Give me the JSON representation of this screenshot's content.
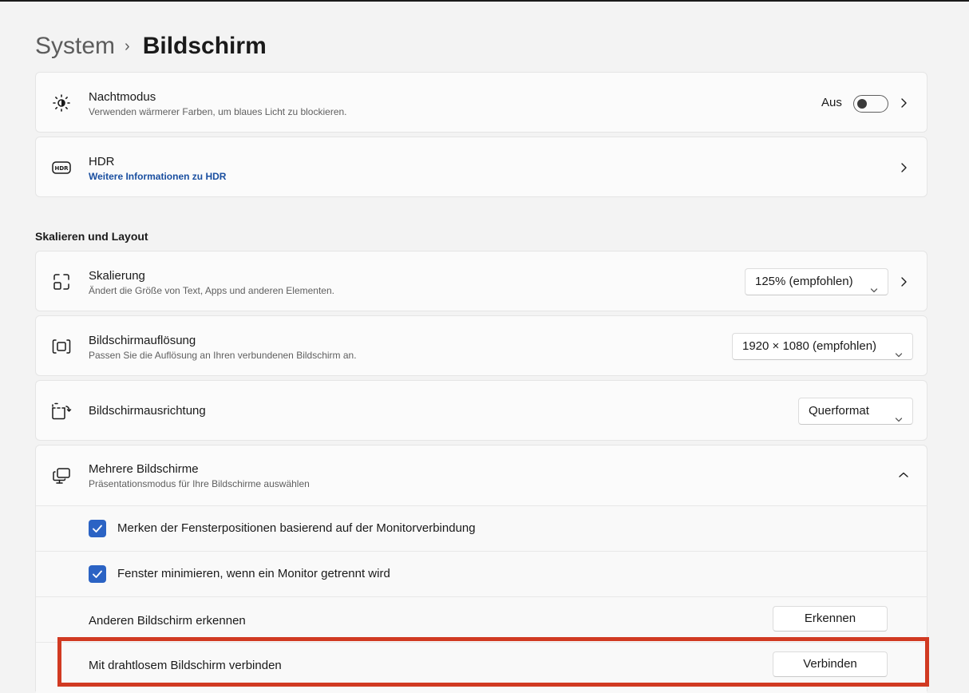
{
  "breadcrumb": {
    "parent": "System",
    "separator": "›",
    "current": "Bildschirm"
  },
  "night_mode": {
    "title": "Nachtmodus",
    "subtitle": "Verwenden wärmerer Farben, um blaues Licht zu blockieren.",
    "toggle_label": "Aus",
    "toggle_on": false,
    "icon": "brightness-icon"
  },
  "hdr": {
    "title": "HDR",
    "link": "Weitere Informationen zu HDR",
    "icon": "hdr-icon"
  },
  "section": {
    "label": "Skalieren und Layout"
  },
  "scaling": {
    "title": "Skalierung",
    "subtitle": "Ändert die Größe von Text, Apps und anderen Elementen.",
    "selected": "125% (empfohlen)",
    "icon": "scale-icon"
  },
  "resolution": {
    "title": "Bildschirmauflösung",
    "subtitle": "Passen Sie die Auflösung an Ihren verbundenen Bildschirm an.",
    "selected": "1920 × 1080 (empfohlen)",
    "icon": "resolution-icon"
  },
  "orientation": {
    "title": "Bildschirmausrichtung",
    "selected": "Querformat",
    "icon": "orientation-icon"
  },
  "multiple_displays": {
    "title": "Mehrere Bildschirme",
    "subtitle": "Präsentationsmodus für Ihre Bildschirme auswählen",
    "icon": "multiple-displays-icon",
    "expanded": true,
    "options": [
      {
        "label": "Merken der Fensterpositionen basierend auf der Monitorverbindung",
        "checked": true
      },
      {
        "label": "Fenster minimieren, wenn ein Monitor getrennt wird",
        "checked": true
      }
    ],
    "detect": {
      "label": "Anderen Bildschirm erkennen",
      "button": "Erkennen"
    },
    "wireless": {
      "label": "Mit drahtlosem Bildschirm verbinden",
      "button": "Verbinden"
    }
  },
  "colors": {
    "accent": "#2b63c4",
    "link": "#1a4fa0",
    "highlight": "#d13a22"
  }
}
